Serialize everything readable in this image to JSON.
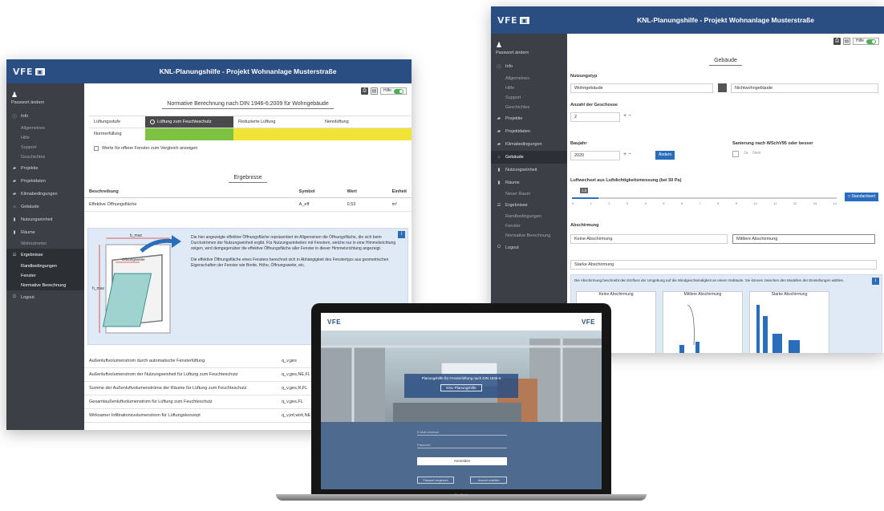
{
  "left_window": {
    "logo": "VFE",
    "title": "KNL-Planungshilfe - Projekt Wohnanlage Musterstraße",
    "sidebar": {
      "user": "Passwort ändern",
      "items": [
        {
          "label": "Info",
          "icon": "info-icon"
        },
        {
          "label": "Allgemeines",
          "sub": true
        },
        {
          "label": "Hilfe",
          "sub": true
        },
        {
          "label": "Support",
          "sub": true
        },
        {
          "label": "Geschichtes",
          "sub": true
        },
        {
          "label": "Projektie",
          "icon": "folder-icon"
        },
        {
          "label": "Projektdaten",
          "icon": "folder-icon"
        },
        {
          "label": "Klimabedingungen",
          "icon": "thermometer-icon"
        },
        {
          "label": "Gebäude",
          "icon": "building-icon"
        },
        {
          "label": "Nutzungseinheit",
          "icon": "unit-icon"
        },
        {
          "label": "Räume",
          "icon": "rooms-icon"
        },
        {
          "label": "Wohnzimmer",
          "sub": true
        },
        {
          "label": "Ergebnisse",
          "icon": "results-icon",
          "active": true
        },
        {
          "label": "Randbedingungen",
          "sub": true,
          "active": true
        },
        {
          "label": "Fenster",
          "sub": true,
          "active": true
        },
        {
          "label": "Normative Berechnung",
          "sub": true,
          "active": true
        },
        {
          "label": "Logout",
          "icon": "logout-icon"
        }
      ]
    },
    "toolbar": {
      "help_label": "Hilfe"
    },
    "section_title": "Normative Berechnung nach DIN 1946-6:2009 für Wohngebäude",
    "ventilation": {
      "label": "Lüftungsstufe",
      "tabs": [
        "Lüftung zum Feuchteschutz",
        "Reduzierte Lüftung",
        "Nennlüftung"
      ],
      "row2_label": "Normerfüllung",
      "checkbox_label": "Werte für offene Fenster zum Vergleich anzeigen"
    },
    "results_title": "Ergebnisse",
    "results_table": {
      "headers": [
        "Beschreibung",
        "Symbol",
        "Wert",
        "Einheit"
      ],
      "rows": [
        [
          "Effektive Öffnungsfläche",
          "A_eff",
          "0,53",
          "m²"
        ]
      ]
    },
    "info_text_1": "Die hier angezeigte effektive Öffnungsfläche repräsentiert im Allgemeinen die Öffnungsfläche, die sich beim Durchströmen der Nutzungseinheit ergibt. Für Nutzungseinheiten mit Fenstern, welche nur in eine Himmelsrichtung zeigen, wird demgegenüber die effektive Öffnungsfläche aller Fenster in dieser Himmelsrichtung angezeigt.",
    "info_text_2": "Die effektive Öffnungsfläche eines Fensters berechnet sich in Abhängigkeit des Fenstertyps aus geometrischen Eigenschaften der Fenster wie Breite, Höhe, Öffnungsweite, etc.",
    "diagram_labels": {
      "top": "b_max",
      "mid": "Öffnungsweite",
      "side": "h_max"
    },
    "lower_rows": [
      [
        "Außenluftvolumenstrom durch automatische Fensterlüftung",
        "q_v,ges"
      ],
      [
        "Außenluftvolumenstrom der Nutzungseinheit für Lüftung zum Feuchteschutz",
        "q_v,ges,NE,FL"
      ],
      [
        "Summe der Außenluftvolumenströme der Räume für Lüftung zum Feuchteschutz",
        "q_v,ges,R,FL"
      ],
      [
        "Gesamtaußenluftvolumenstrom für Lüftung zum Feuchteschutz",
        "q_v,ges,FL"
      ],
      [
        "Wirksamer Infiltrationsvolumenstrom für Lüftungskonzept",
        "q_v,inf,wirk,NE"
      ]
    ]
  },
  "right_window": {
    "logo": "VFE",
    "title": "KNL-Planungshilfe - Projekt Wohnanlage Musterstraße",
    "sidebar": {
      "user": "Passwort ändern",
      "items": [
        {
          "label": "Info",
          "icon": "info-icon"
        },
        {
          "label": "Allgemeines",
          "sub": true
        },
        {
          "label": "Hilfe",
          "sub": true
        },
        {
          "label": "Support",
          "sub": true
        },
        {
          "label": "Geschichtes",
          "sub": true
        },
        {
          "label": "Projektie",
          "icon": "folder-icon"
        },
        {
          "label": "Projektdaten",
          "icon": "folder-icon"
        },
        {
          "label": "Klimabedingungen",
          "icon": "thermometer-icon"
        },
        {
          "label": "Gebäude",
          "icon": "building-icon",
          "active": true
        },
        {
          "label": "Nutzungseinheit",
          "icon": "unit-icon"
        },
        {
          "label": "Räume",
          "icon": "rooms-icon"
        },
        {
          "label": "Neuer Raum",
          "sub": true
        },
        {
          "label": "Ergebnisse",
          "icon": "results-icon"
        },
        {
          "label": "Randbedingungen",
          "sub": true
        },
        {
          "label": "Fenster",
          "sub": true
        },
        {
          "label": "Normative Berechnung",
          "sub": true
        },
        {
          "label": "Logout",
          "icon": "logout-icon"
        }
      ]
    },
    "toolbar": {
      "help_label": "Hilfe"
    },
    "section_title": "Gebäude",
    "nutzungstyp": {
      "label": "Nutzungstyp",
      "option_a": "Wohngebäude",
      "option_b": "Nichtwohngebäude"
    },
    "geschosse": {
      "label": "Anzahl der Geschosse",
      "value": "2"
    },
    "baujahr": {
      "label": "Baujahr",
      "value": "2020",
      "button": "Ändern"
    },
    "sanierung": {
      "label": "Sanierung nach WSchV95 oder besser",
      "ja": "Ja",
      "nein": "Nein"
    },
    "luftwechsel": {
      "label": "Luftwechsel aus Luftdichtigkeitsmessung (bei 50 Pa)",
      "value": "1,5",
      "fraction": 0.1,
      "ticks": [
        "0",
        "1",
        "2",
        "3",
        "4",
        "5",
        "6",
        "7",
        "8",
        "9",
        "10",
        "11",
        "12",
        "13",
        "14"
      ],
      "button": "Standardwert"
    },
    "abschirmung": {
      "label": "Abschirmung",
      "options": [
        "Keine Abschirmung",
        "Mittlere Abschirmung",
        "Starke Abschirmung"
      ],
      "info": "Die Abschirmung beschreibt den Einfluss der Umgebung auf die Windgeschwindigkeit an einem Gebäude. Sie können zwischen den Modellen der Einstellungen wählen.",
      "images": [
        "Keine Abschirmung",
        "Mittlere Abschirmung",
        "Starke Abschirmung"
      ]
    }
  },
  "laptop": {
    "logo": "VFE",
    "modal_text": "Planungshilfe für Fensterlüftung nach DIN 1946-6",
    "modal_button": "KNL-Planungshilfe",
    "login_button": "Anmelden",
    "field_1": "E-Mail-Adresse",
    "field_2": "Passwort",
    "link_left": "Passwort vergessen",
    "link_right": "Account erstellen",
    "brand": "MacBook"
  }
}
